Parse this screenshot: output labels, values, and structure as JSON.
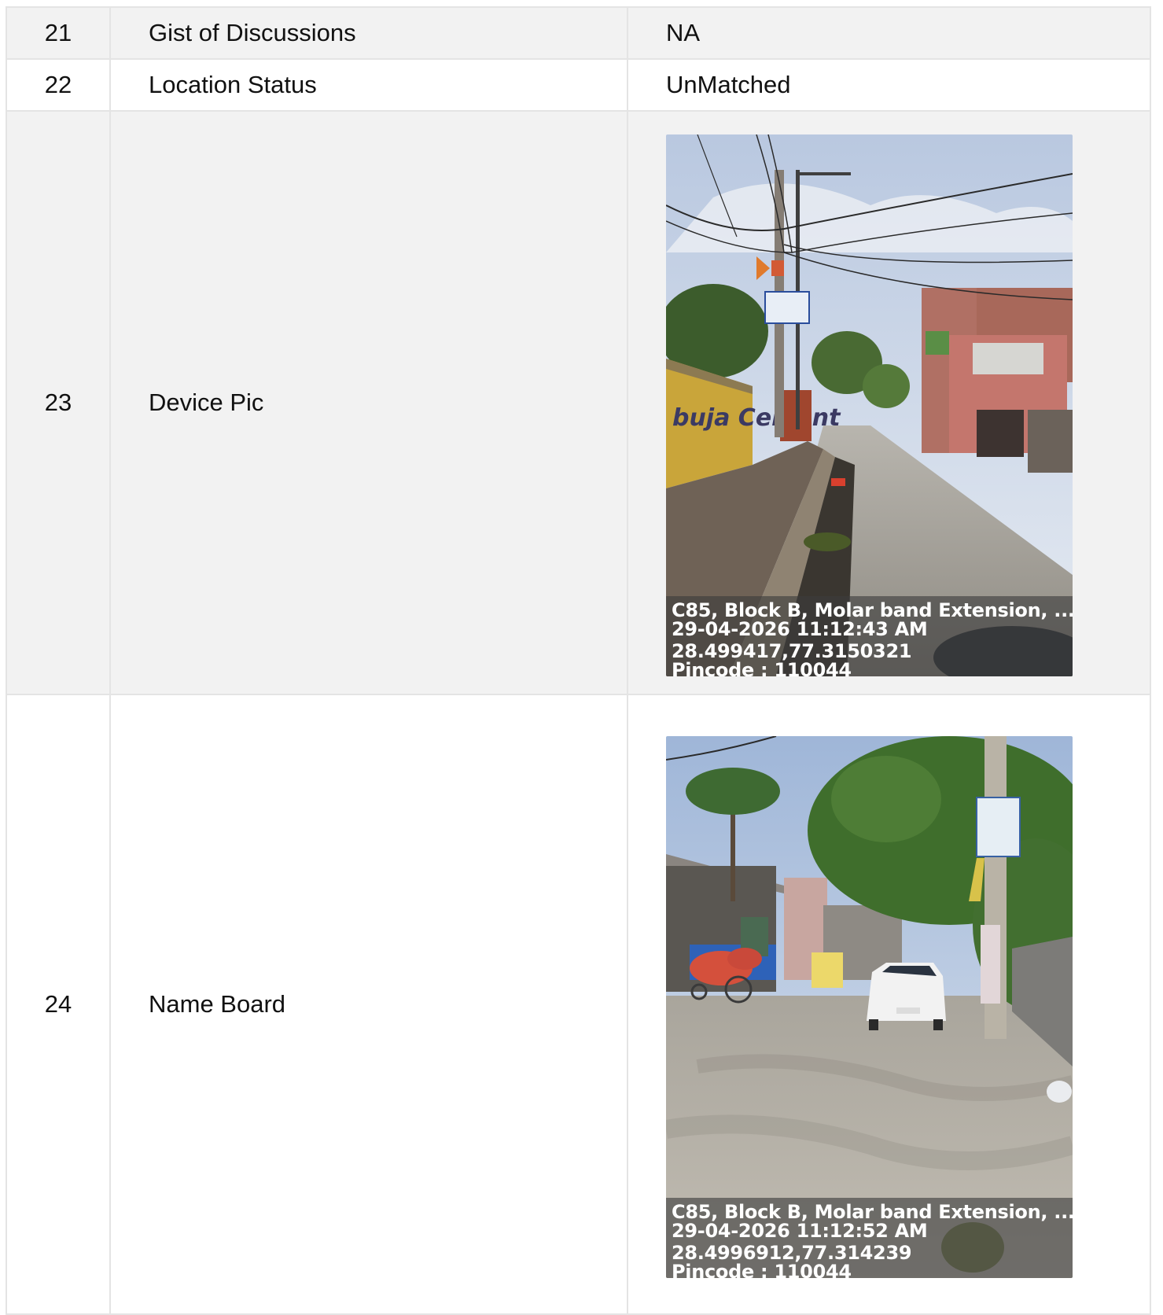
{
  "rows": [
    {
      "num": "21",
      "label": "Gist of Discussions",
      "value": "NA"
    },
    {
      "num": "22",
      "label": "Location Status",
      "value": "UnMatched"
    },
    {
      "num": "23",
      "label": "Device Pic",
      "photo": {
        "address": "C85, Block B, Molar band Extension, ...",
        "datetime": "29-04-2026 11:12:43 AM",
        "coords": "28.499417,77.3150321",
        "pincode": "Pincode : 110044",
        "wall_text": "buja Cement"
      }
    },
    {
      "num": "24",
      "label": "Name Board",
      "photo": {
        "address": "C85, Block B, Molar band Extension, ...",
        "datetime": "29-04-2026 11:12:52 AM",
        "coords": "28.4996912,77.314239",
        "pincode": "Pincode : 110044"
      }
    }
  ],
  "colors": {
    "shaded_row": "#f2f2f2",
    "border": "#e4e4e4",
    "caption_overlay": "#3c3c3c"
  }
}
